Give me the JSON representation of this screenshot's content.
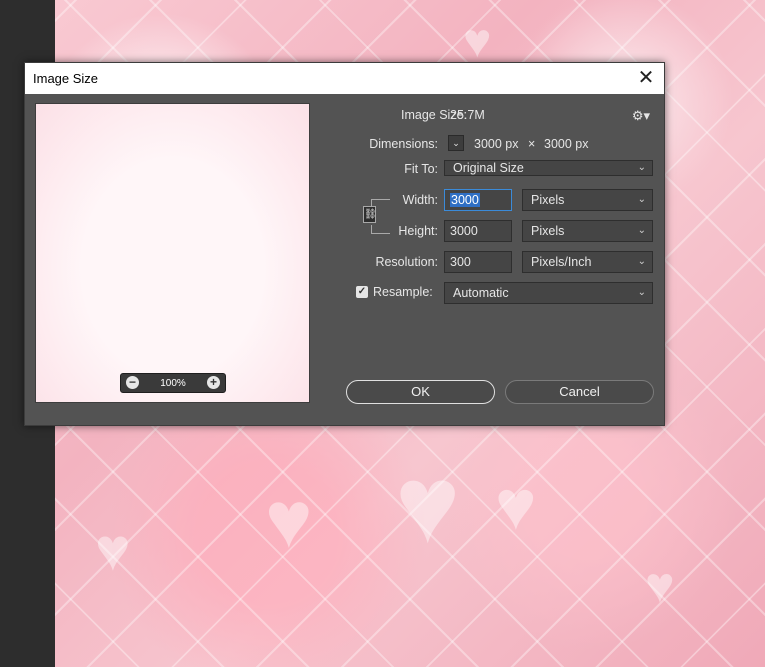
{
  "dialog": {
    "title": "Image Size",
    "close_glyph": "✕",
    "gear_glyph": "⚙▾"
  },
  "preview": {
    "zoom_minus": "−",
    "zoom_value": "100%",
    "zoom_plus": "+"
  },
  "info": {
    "image_size_label": "Image Size:",
    "image_size_value": "25.7M",
    "dimensions_label": "Dimensions:",
    "dimensions_w": "3000 px",
    "dimensions_x": "×",
    "dimensions_h": "3000 px",
    "fit_to_label": "Fit To:",
    "fit_to_value": "Original Size"
  },
  "size": {
    "width_label": "Width:",
    "width_value": "3000",
    "width_unit": "Pixels",
    "height_label": "Height:",
    "height_value": "3000",
    "height_unit": "Pixels",
    "resolution_label": "Resolution:",
    "resolution_value": "300",
    "resolution_unit": "Pixels/Inch",
    "resample_label": "Resample:",
    "resample_checked": true,
    "resample_value": "Automatic"
  },
  "buttons": {
    "ok": "OK",
    "cancel": "Cancel"
  },
  "icons": {
    "close": "close-icon",
    "gear": "gear-icon",
    "chain": "link-chain-icon",
    "dimensions_toggle": "chevron-down-icon",
    "zoom_in": "zoom-in-icon",
    "zoom_out": "zoom-out-icon",
    "checkbox": "checkmark-icon"
  },
  "colors": {
    "dialog_bg": "#535353",
    "field_bg": "#454545",
    "focus_border": "#3b8bd9",
    "canvas_pink": "#f3b3c0"
  }
}
